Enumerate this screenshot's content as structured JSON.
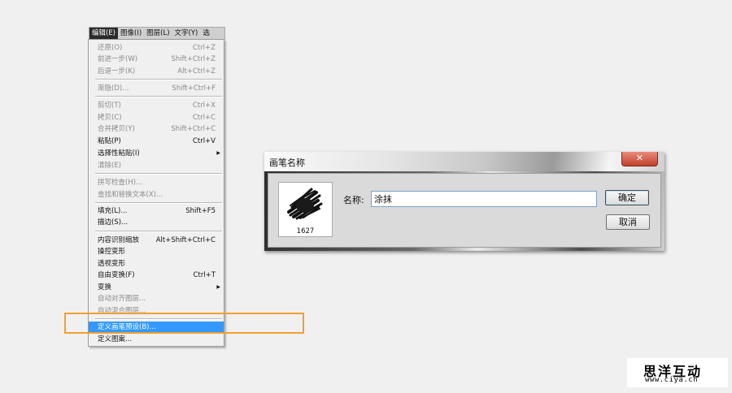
{
  "menubar": {
    "items": [
      "编辑(E)",
      "图像(I)",
      "图层(L)",
      "文字(Y)",
      "选"
    ]
  },
  "edit_menu": {
    "items": [
      {
        "label": "还原(O)",
        "shortcut": "Ctrl+Z",
        "state": "disabled"
      },
      {
        "label": "前进一步(W)",
        "shortcut": "Shift+Ctrl+Z",
        "state": "disabled"
      },
      {
        "label": "后退一步(K)",
        "shortcut": "Alt+Ctrl+Z",
        "state": "disabled"
      },
      {
        "label": "渐隐(D)...",
        "shortcut": "Shift+Ctrl+F",
        "state": "disabled"
      },
      {
        "label": "剪切(T)",
        "shortcut": "Ctrl+X",
        "state": "disabled"
      },
      {
        "label": "拷贝(C)",
        "shortcut": "Ctrl+C",
        "state": "disabled"
      },
      {
        "label": "合并拷贝(Y)",
        "shortcut": "Shift+Ctrl+C",
        "state": "disabled"
      },
      {
        "label": "粘贴(P)",
        "shortcut": "Ctrl+V",
        "state": "enabled"
      },
      {
        "label": "选择性粘贴(I)",
        "shortcut": "",
        "state": "enabled",
        "submenu": true
      },
      {
        "label": "清除(E)",
        "shortcut": "",
        "state": "disabled"
      },
      {
        "label": "拼写检查(H)...",
        "shortcut": "",
        "state": "disabled"
      },
      {
        "label": "查找和替换文本(X)...",
        "shortcut": "",
        "state": "disabled"
      },
      {
        "label": "填充(L)...",
        "shortcut": "Shift+F5",
        "state": "enabled"
      },
      {
        "label": "描边(S)...",
        "shortcut": "",
        "state": "enabled"
      },
      {
        "label": "内容识别缩放",
        "shortcut": "Alt+Shift+Ctrl+C",
        "state": "enabled"
      },
      {
        "label": "操控变形",
        "shortcut": "",
        "state": "enabled"
      },
      {
        "label": "透视变形",
        "shortcut": "",
        "state": "enabled"
      },
      {
        "label": "自由变换(F)",
        "shortcut": "Ctrl+T",
        "state": "enabled"
      },
      {
        "label": "变换",
        "shortcut": "",
        "state": "enabled",
        "submenu": true
      },
      {
        "label": "自动对齐图层...",
        "shortcut": "",
        "state": "disabled"
      },
      {
        "label": "自动混合图层...",
        "shortcut": "",
        "state": "disabled"
      },
      {
        "label": "定义画笔预设(B)...",
        "shortcut": "",
        "state": "highlighted"
      },
      {
        "label": "定义图案...",
        "shortcut": "",
        "state": "enabled"
      }
    ]
  },
  "dialog": {
    "title": "画笔名称",
    "close_glyph": "✕",
    "brush_size": "1627",
    "name_label": "名称:",
    "name_value": "涂抹",
    "ok_label": "确定",
    "cancel_label": "取消"
  },
  "watermark": {
    "name": "思洋互动",
    "url": "www.ciya.cn"
  },
  "colors": {
    "highlight": "#3399ff",
    "callout": "#f0a030",
    "close_button": "#c2412d"
  }
}
